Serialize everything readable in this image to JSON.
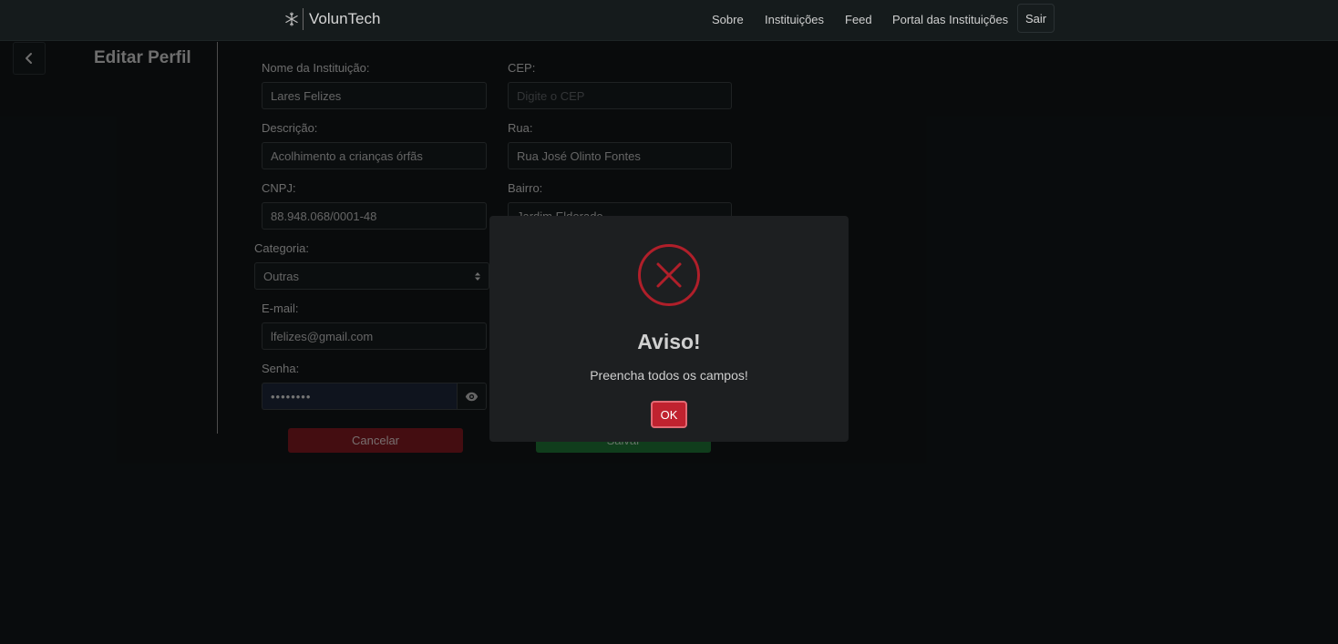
{
  "app": {
    "name": "VolunTech"
  },
  "nav": {
    "links": [
      "Sobre",
      "Instituições",
      "Feed",
      "Portal das Instituições"
    ],
    "logout_label": "Sair"
  },
  "page": {
    "title": "Editar Perfil"
  },
  "form": {
    "name": {
      "label": "Nome da Instituição:",
      "value": "Lares Felizes"
    },
    "description": {
      "label": "Descrição:",
      "value": "Acolhimento a crianças órfãs"
    },
    "cnpj": {
      "label": "CNPJ:",
      "value": "88.948.068/0001-48"
    },
    "category": {
      "label": "Categoria:",
      "value": "Outras"
    },
    "email": {
      "label": "E-mail:",
      "value": "lfelizes@gmail.com"
    },
    "password": {
      "label": "Senha:",
      "value": "••••••••"
    },
    "cep": {
      "label": "CEP:",
      "placeholder": "Digite o CEP"
    },
    "street": {
      "label": "Rua:",
      "value": "Rua José Olinto Fontes"
    },
    "neighborhood": {
      "label": "Bairro:",
      "value": "Jardim Eldorado"
    },
    "cancel_label": "Cancelar",
    "save_label": "Salvar"
  },
  "modal": {
    "title": "Aviso!",
    "message": "Preencha todos os campos!",
    "ok_label": "OK",
    "icon": "error-x-icon",
    "accent": "#c0222f"
  },
  "colors": {
    "background": "#111517",
    "navbar": "#151b1c",
    "cancel": "#7d1820",
    "save": "#1e6f34"
  }
}
